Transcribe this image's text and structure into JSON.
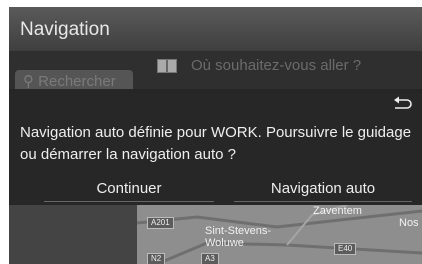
{
  "header": {
    "title": "Navigation"
  },
  "search": {
    "button_label": "Rechercher",
    "destination_placeholder": "Où souhaitez-vous aller ?"
  },
  "dialog": {
    "message_line1": "Navigation auto définie pour WORK. Poursuivre le guidage",
    "message_line2": "ou démarrer la navigation auto ?",
    "continue_label": "Continuer",
    "auto_nav_label": "Navigation auto"
  },
  "map": {
    "place_sint_stevens": "Sint-Stevens-",
    "place_woluwe": "Woluwe",
    "place_zaventem": "Zaventem",
    "place_partial": "Nos",
    "road_a201": "A201",
    "road_e40": "E40",
    "road_n2": "N2",
    "road_a3": "A3"
  },
  "colors": {
    "screen_bg": "#3a3a3a",
    "dialog_bg": "#262626",
    "text": "#eeeeee",
    "dim_text": "#6b6b6b"
  },
  "icons": {
    "back": "back-arrow-icon",
    "destination": "destination-flag-icon",
    "search": "search-icon"
  }
}
